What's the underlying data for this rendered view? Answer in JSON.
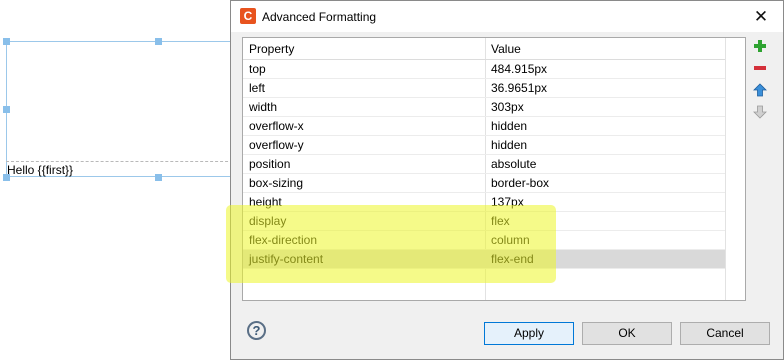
{
  "canvas": {
    "text": "Hello {{first}}"
  },
  "dialog": {
    "title": "Advanced Formatting",
    "app_icon": "C",
    "close_glyph": "✕",
    "columns": [
      "Property",
      "Value"
    ],
    "rows": [
      {
        "property": "top",
        "value": "484.915px"
      },
      {
        "property": "left",
        "value": "36.9651px"
      },
      {
        "property": "width",
        "value": "303px"
      },
      {
        "property": "overflow-x",
        "value": "hidden"
      },
      {
        "property": "overflow-y",
        "value": "hidden"
      },
      {
        "property": "position",
        "value": "absolute"
      },
      {
        "property": "box-sizing",
        "value": "border-box"
      },
      {
        "property": "height",
        "value": "137px"
      },
      {
        "property": "display",
        "value": "flex"
      },
      {
        "property": "flex-direction",
        "value": "column"
      },
      {
        "property": "justify-content",
        "value": "flex-end"
      }
    ],
    "selected_row": "justify-content",
    "highlighted_rows": [
      "display",
      "flex-direction",
      "justify-content"
    ],
    "tools": [
      "add-icon",
      "remove-icon",
      "move-up-icon",
      "move-down-icon"
    ],
    "help_glyph": "?",
    "buttons": {
      "apply": "Apply",
      "ok": "OK",
      "cancel": "Cancel"
    }
  },
  "colors": {
    "highlight": "#ecf628",
    "selection": "#d9d9d9",
    "handle": "#89bfea",
    "app_icon": "#e8531e"
  }
}
